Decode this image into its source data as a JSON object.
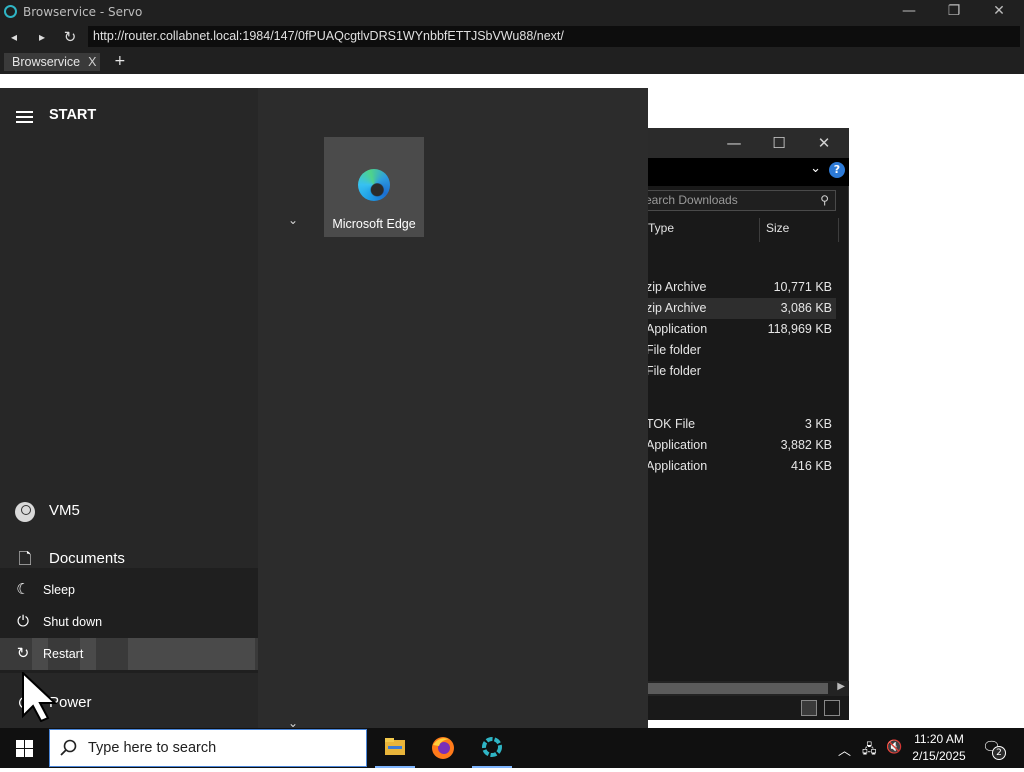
{
  "browser": {
    "title": "Browservice - Servo",
    "url": "http://router.collabnet.local:1984/147/0fPUAQcgtlvDRS1WYnbbfETTJSbVWu88/next/",
    "tab_label": "Browservice",
    "tab_close": "X",
    "new_tab": "+",
    "min_glyph": "—",
    "max_glyph": "❐",
    "close_glyph": "✕",
    "back_glyph": "◂",
    "fwd_glyph": "▸",
    "reload_glyph": "↻"
  },
  "explorer": {
    "search_placeholder": "earch Downloads",
    "columns": {
      "type": "Type",
      "size": "Size"
    },
    "help": "?",
    "rows": [
      {
        "type": "zip Archive",
        "size": "10,771 KB",
        "selected": false
      },
      {
        "type": "zip Archive",
        "size": "3,086 KB",
        "selected": true
      },
      {
        "type": "Application",
        "size": "118,969 KB",
        "selected": false
      },
      {
        "type": "File folder",
        "size": "",
        "selected": false
      },
      {
        "type": "File folder",
        "size": "",
        "selected": false
      },
      {
        "type": "TOK File",
        "size": "3 KB",
        "selected": false
      },
      {
        "type": "Application",
        "size": "3,882 KB",
        "selected": false
      },
      {
        "type": "Application",
        "size": "416 KB",
        "selected": false
      }
    ]
  },
  "start_menu": {
    "header": "START",
    "tiles": [
      {
        "label": "Microsoft Edge",
        "icon": "edge-icon"
      }
    ],
    "user": "VM5",
    "documents": "Documents",
    "power": "Power",
    "power_options": [
      {
        "label": "Sleep",
        "icon": "moon-icon"
      },
      {
        "label": "Shut down",
        "icon": "power-icon"
      },
      {
        "label": "Restart",
        "icon": "restart-icon"
      }
    ]
  },
  "taskbar": {
    "search_placeholder": "Type here to search",
    "apps": [
      "file-explorer-icon",
      "firefox-icon",
      "servo-icon"
    ],
    "time": "11:20 AM",
    "date": "2/15/2025",
    "notifications": "2",
    "accent": "#4a86d9"
  }
}
